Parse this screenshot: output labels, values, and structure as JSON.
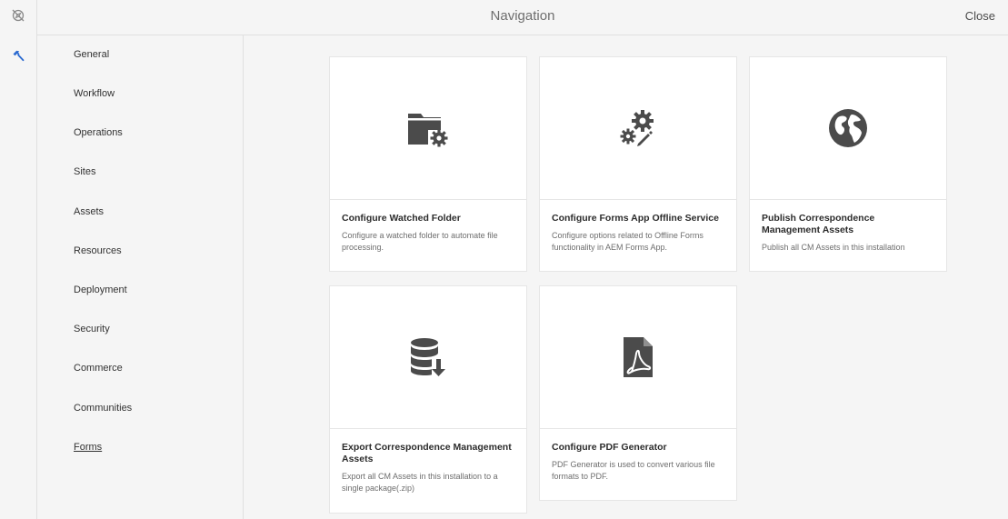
{
  "rail": {
    "items": [
      {
        "icon": "compass-off-icon"
      },
      {
        "icon": "hammer-icon"
      }
    ]
  },
  "header": {
    "title": "Navigation",
    "close_label": "Close"
  },
  "nav": {
    "items": [
      {
        "label": "General"
      },
      {
        "label": "Workflow"
      },
      {
        "label": "Operations"
      },
      {
        "label": "Sites"
      },
      {
        "label": "Assets"
      },
      {
        "label": "Resources"
      },
      {
        "label": "Deployment"
      },
      {
        "label": "Security"
      },
      {
        "label": "Commerce"
      },
      {
        "label": "Communities"
      },
      {
        "label": "Forms"
      }
    ],
    "active": "Forms"
  },
  "cards": [
    {
      "icon": "folder-settings-icon",
      "title": "Configure Watched Folder",
      "description": "Configure a watched folder to automate file processing."
    },
    {
      "icon": "gears-icon",
      "title": "Configure Forms App Offline Service",
      "description": "Configure options related to Offline Forms functionality in AEM Forms App."
    },
    {
      "icon": "globe-icon",
      "title": "Publish Correspondence Management Assets",
      "description": "Publish all CM Assets in this installation"
    },
    {
      "icon": "database-export-icon",
      "title": "Export Correspondence Management Assets",
      "description": "Export all CM Assets in this installation to a single package(.zip)"
    },
    {
      "icon": "pdf-icon",
      "title": "Configure PDF Generator",
      "description": "PDF Generator is used to convert various file formats to PDF."
    }
  ],
  "colors": {
    "accent": "#2b6ad0",
    "icon_gray": "#4b4b4b",
    "background": "#f5f5f5"
  }
}
